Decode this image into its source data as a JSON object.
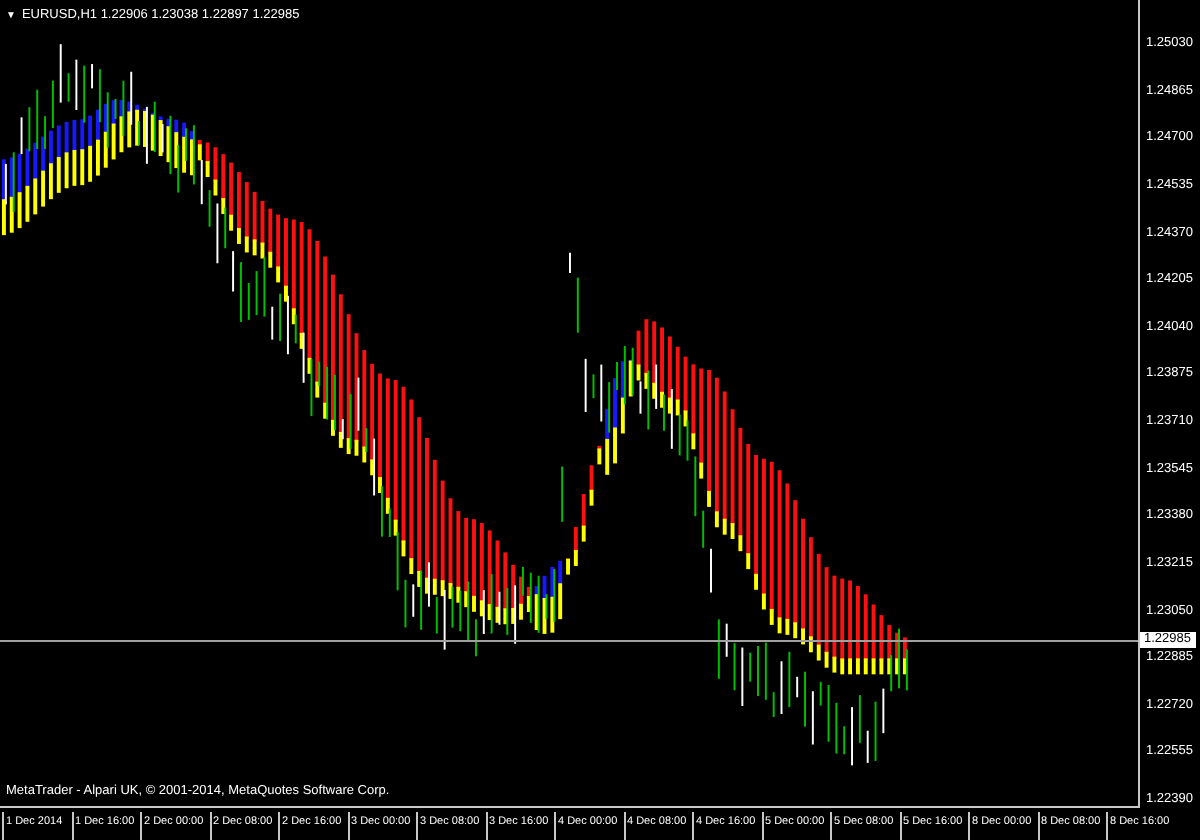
{
  "chart": {
    "menu_glyph": "▼",
    "header": "EURUSD,H1  1.22906 1.23038 1.22897 1.22985",
    "price_labels": [
      "1.25030",
      "1.24865",
      "1.24700",
      "1.24535",
      "1.24370",
      "1.24205",
      "1.24040",
      "1.23875",
      "1.23710",
      "1.23545",
      "1.23380",
      "1.23215",
      "1.23050",
      "1.22885",
      "1.22720",
      "1.22555",
      "1.22390"
    ],
    "current_price": "1.22985",
    "copyright": "MetaTrader - Alpari UK, © 2001-2014, MetaQuotes Software Corp.",
    "time_labels": [
      "1 Dec 2014",
      "1 Dec 16:00",
      "2 Dec 00:00",
      "2 Dec 08:00",
      "2 Dec 16:00",
      "3 Dec 00:00",
      "3 Dec 08:00",
      "3 Dec 16:00",
      "4 Dec 00:00",
      "4 Dec 08:00",
      "4 Dec 16:00",
      "5 Dec 00:00",
      "5 Dec 08:00",
      "5 Dec 16:00",
      "8 Dec 00:00",
      "8 Dec 08:00",
      "8 Dec 16:00"
    ]
  }
}
